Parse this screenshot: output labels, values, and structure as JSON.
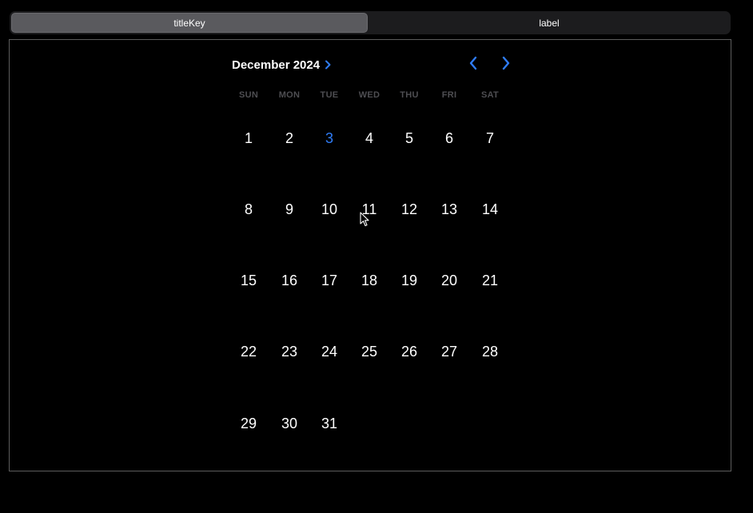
{
  "segmented_control": {
    "segments": [
      {
        "label": "titleKey",
        "selected": true
      },
      {
        "label": "label",
        "selected": false
      }
    ]
  },
  "calendar": {
    "month_label": "December 2024",
    "accent_color": "#2f7cf6",
    "today": 3,
    "weekdays": [
      "SUN",
      "MON",
      "TUE",
      "WED",
      "THU",
      "FRI",
      "SAT"
    ],
    "days": [
      [
        "1",
        "2",
        "3",
        "4",
        "5",
        "6",
        "7"
      ],
      [
        "8",
        "9",
        "10",
        "11",
        "12",
        "13",
        "14"
      ],
      [
        "15",
        "16",
        "17",
        "18",
        "19",
        "20",
        "21"
      ],
      [
        "22",
        "23",
        "24",
        "25",
        "26",
        "27",
        "28"
      ],
      [
        "29",
        "30",
        "31"
      ]
    ],
    "icons": {
      "month_disclosure": "chevron-right-icon",
      "previous_month": "chevron-left-icon",
      "next_month": "chevron-right-icon"
    }
  }
}
